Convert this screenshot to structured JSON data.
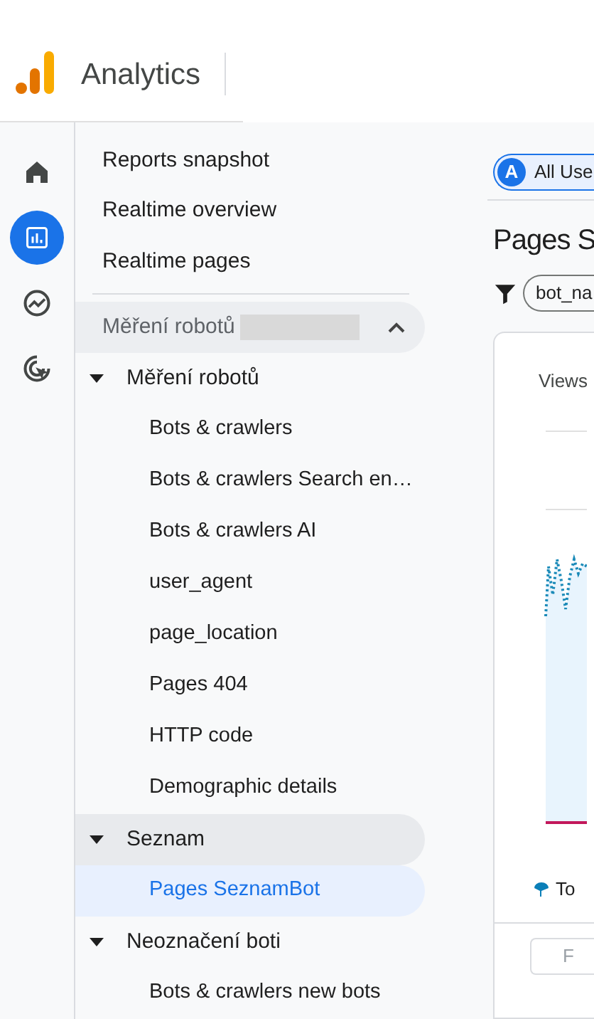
{
  "header": {
    "product": "Analytics"
  },
  "rail": [
    {
      "kind": "home",
      "selected": false
    },
    {
      "kind": "reports",
      "selected": true
    },
    {
      "kind": "explore",
      "selected": false
    },
    {
      "kind": "advertising",
      "selected": false
    }
  ],
  "nav": {
    "top_items": [
      "Reports snapshot",
      "Realtime overview",
      "Realtime pages"
    ],
    "section": {
      "title": "Měření robotů",
      "expanded": true
    },
    "groups": [
      {
        "title": "Měření robotů",
        "expanded": true,
        "highlighted": false,
        "children": [
          {
            "label": "Bots & crawlers",
            "selected": false
          },
          {
            "label": "Bots & crawlers Search en…",
            "selected": false
          },
          {
            "label": "Bots & crawlers AI",
            "selected": false
          },
          {
            "label": "user_agent",
            "selected": false
          },
          {
            "label": "page_location",
            "selected": false
          },
          {
            "label": "Pages 404",
            "selected": false
          },
          {
            "label": "HTTP code",
            "selected": false
          },
          {
            "label": "Demographic details",
            "selected": false
          }
        ]
      },
      {
        "title": "Seznam",
        "expanded": true,
        "highlighted": true,
        "children": [
          {
            "label": "Pages SeznamBot",
            "selected": true
          }
        ]
      },
      {
        "title": "Neoznačení boti",
        "expanded": true,
        "highlighted": false,
        "children": [
          {
            "label": "Bots & crawlers new bots",
            "selected": false
          }
        ]
      }
    ]
  },
  "main": {
    "segment_chip": {
      "letter": "A",
      "label": "All Use"
    },
    "title": "Pages S",
    "filter_chip": "bot_na",
    "card": {
      "metric": "Views",
      "legend": "To",
      "button": "F"
    }
  }
}
